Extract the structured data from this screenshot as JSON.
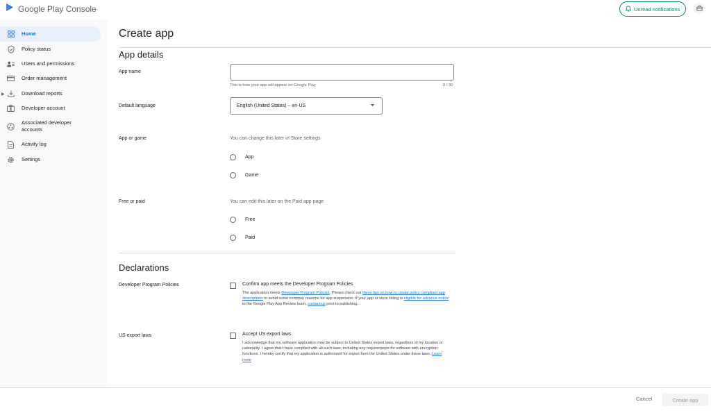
{
  "app": {
    "logo_text": "Google Play Console"
  },
  "header": {
    "notifications_label": "Unread notifications"
  },
  "sidebar": {
    "items": [
      {
        "label": "Home",
        "icon": "grid-icon"
      },
      {
        "label": "Policy status",
        "icon": "shield-icon"
      },
      {
        "label": "Users and permissions",
        "icon": "users-icon"
      },
      {
        "label": "Order management",
        "icon": "card-icon"
      },
      {
        "label": "Download reports",
        "icon": "download-icon"
      },
      {
        "label": "Developer account",
        "icon": "id-badge-icon"
      },
      {
        "label": "Associated developer accounts",
        "icon": "link-accounts-icon"
      },
      {
        "label": "Activity log",
        "icon": "document-icon"
      },
      {
        "label": "Settings",
        "icon": "gear-icon"
      }
    ]
  },
  "page": {
    "title": "Create app"
  },
  "app_details": {
    "heading": "App details",
    "app_name": {
      "label": "App name",
      "value": "",
      "placeholder": "",
      "hint": "This is how your app will appear on Google Play",
      "counter": "0 / 30"
    },
    "default_language": {
      "label": "Default language",
      "value": "English (United States) – en-US"
    },
    "app_or_game": {
      "label": "App or game",
      "helper": "You can change this later in Store settings",
      "options": [
        "App",
        "Game"
      ]
    },
    "free_or_paid": {
      "label": "Free or paid",
      "helper": "You can edit this later on the Paid app page",
      "options": [
        "Free",
        "Paid"
      ]
    }
  },
  "declarations": {
    "heading": "Declarations",
    "dev_policies": {
      "label": "Developer Program Policies",
      "checkbox_label": "Confirm app meets the Developer Program Policies",
      "desc_1": "The application meets ",
      "link_1": "Developer Program Policies",
      "desc_2": ". Please check out ",
      "link_2": "these tips on how to create policy compliant app descriptions",
      "desc_3": " to avoid some common reasons for app suspension. If your app or store listing is ",
      "link_3": "eligible for advance notice",
      "desc_4": " to the Google Play App Review team, ",
      "link_4": "contact us",
      "desc_5": " prior to publishing."
    },
    "export_laws": {
      "label": "US export laws",
      "checkbox_label": "Accept US export laws",
      "desc": "I acknowledge that my software application may be subject to United States export laws, regardless of my location or nationality. I agree that I have complied with all such laws, including any requirements for software with encryption functions. I hereby certify that my application is authorized for export from the United States under these laws. ",
      "link": "Learn more"
    }
  },
  "footer": {
    "cancel_label": "Cancel",
    "create_label": "Create app"
  },
  "colors": {
    "accent": "#1a73e8",
    "brand_green": "#01875f",
    "active_bg": "#e8f0fe"
  }
}
